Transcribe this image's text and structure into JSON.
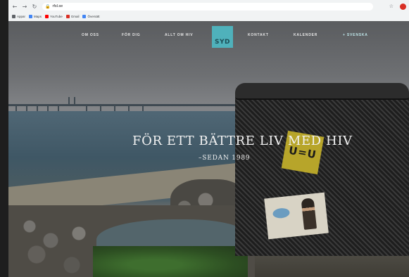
{
  "browser": {
    "url": "rfsl.se",
    "bookmarks": [
      {
        "label": "Appar",
        "icon": "apps-grid-icon",
        "color": "#5f6368"
      },
      {
        "label": "Maps",
        "icon": "maps-icon",
        "color": "#4285f4"
      },
      {
        "label": "YouTube",
        "icon": "youtube-icon",
        "color": "#ff0000"
      },
      {
        "label": "Gmail",
        "icon": "gmail-icon",
        "color": "#d93025"
      },
      {
        "label": "Översätt",
        "icon": "translate-icon",
        "color": "#4285f4"
      }
    ]
  },
  "site": {
    "nav": {
      "about": "OM OSS",
      "for_you": "FÖR DIG",
      "all_about_hiv": "ALLT OM HIV",
      "contact": "KONTAKT",
      "calendar": "KALENDER",
      "language": "+ SVENSKA"
    },
    "logo_text": "SYD",
    "logo_color": "#4fb1bb",
    "hero": {
      "heading": "FÖR ETT BÄTTRE LIV MED HIV",
      "subheading": "–SEDAN 1989"
    },
    "sticker": {
      "text": "U=U"
    }
  }
}
